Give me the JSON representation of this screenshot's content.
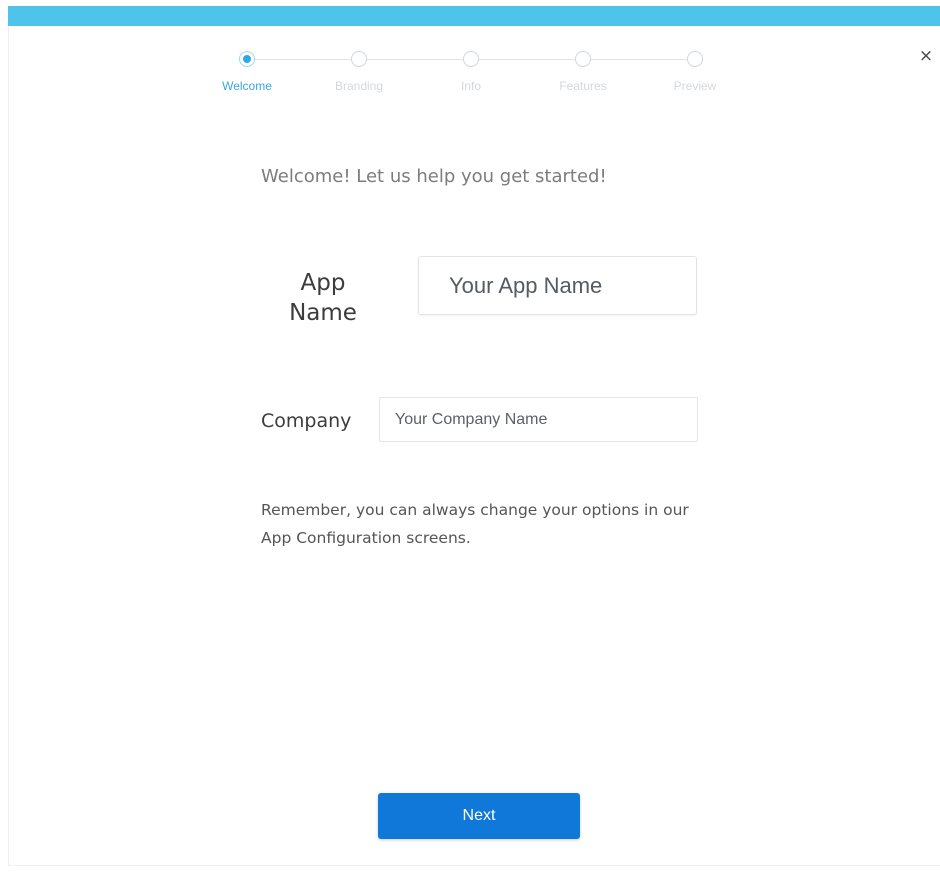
{
  "wizard": {
    "steps": [
      {
        "label": "Welcome",
        "active": true
      },
      {
        "label": "Branding",
        "active": false
      },
      {
        "label": "Info",
        "active": false
      },
      {
        "label": "Features",
        "active": false
      },
      {
        "label": "Preview",
        "active": false
      }
    ],
    "close_symbol": "×"
  },
  "main": {
    "headline": "Welcome! Let us help you get started!",
    "app_name": {
      "label": "App Name",
      "placeholder": "Your App Name",
      "value": ""
    },
    "company": {
      "label": "Company",
      "placeholder": "Your Company Name",
      "value": ""
    },
    "note": "Remember, you can always change your options in our App Configuration screens."
  },
  "footer": {
    "next_label": "Next"
  },
  "colors": {
    "accent": "#4ec4ea",
    "primary_button": "#0f78d9",
    "active_step": "#2ea8e6"
  }
}
